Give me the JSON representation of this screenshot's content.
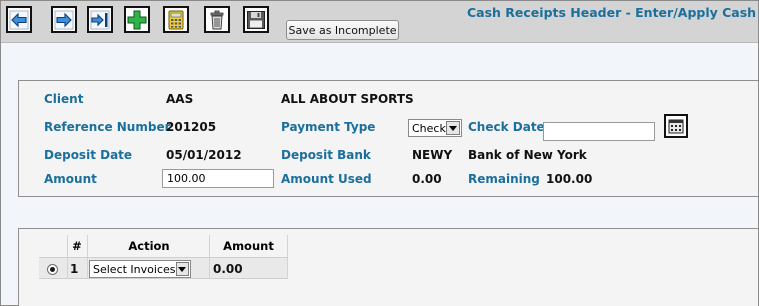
{
  "toolbar": {
    "buttons": [
      {
        "name": "back-button",
        "icon": "arrow-left-icon"
      },
      {
        "name": "forward-button",
        "icon": "arrow-right-icon"
      },
      {
        "name": "apply-button",
        "icon": "arrow-into-icon"
      },
      {
        "name": "add-button",
        "icon": "plus-icon"
      },
      {
        "name": "calculator-button",
        "icon": "calculator-icon"
      },
      {
        "name": "delete-button",
        "icon": "trash-icon"
      },
      {
        "name": "save-button",
        "icon": "floppy-disk-icon"
      }
    ],
    "save_incomplete_label": "Save as Incomplete"
  },
  "page_title": "Cash Receipts Header - Enter/Apply Cash",
  "header": {
    "client_label": "Client",
    "client_code": "AAS",
    "client_name": "ALL ABOUT SPORTS",
    "reference_label": "Reference Number",
    "reference_value": "201205",
    "payment_type_label": "Payment Type",
    "payment_type_value": "Check",
    "check_date_label": "Check Date",
    "check_date_value": "",
    "deposit_date_label": "Deposit Date",
    "deposit_date_value": "05/01/2012",
    "deposit_bank_label": "Deposit Bank",
    "deposit_bank_code": "NEWY",
    "deposit_bank_name": "Bank of New York",
    "amount_label": "Amount",
    "amount_value": "100.00",
    "amount_used_label": "Amount Used",
    "amount_used_value": "0.00",
    "remaining_label": "Remaining",
    "remaining_value": "100.00"
  },
  "grid": {
    "columns": [
      "#",
      "Action",
      "Amount"
    ],
    "rows": [
      {
        "selected": true,
        "number": "1",
        "action": "Select Invoices",
        "amount": "0.00"
      }
    ]
  },
  "colors": {
    "accent": "#1b6f9c",
    "toolbar_bg": "#d4d4d4",
    "page_bg": "#f2f6fb",
    "panel_bg": "#f4f4f4"
  }
}
